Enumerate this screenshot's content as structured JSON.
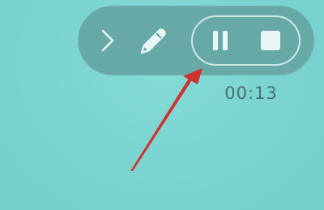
{
  "recorder": {
    "timer": "00:13",
    "buttons": {
      "expand_icon": "chevron-right-icon",
      "annotate_icon": "pencil-icon",
      "pause_icon": "pause-icon",
      "stop_icon": "stop-icon"
    }
  },
  "annotation": {
    "arrow_color": "#d0312d"
  },
  "colors": {
    "background": "#7dd6d3",
    "toolbar": "#67a9a7",
    "icon": "#e8f7f6",
    "timer_text": "#4a6f70"
  }
}
